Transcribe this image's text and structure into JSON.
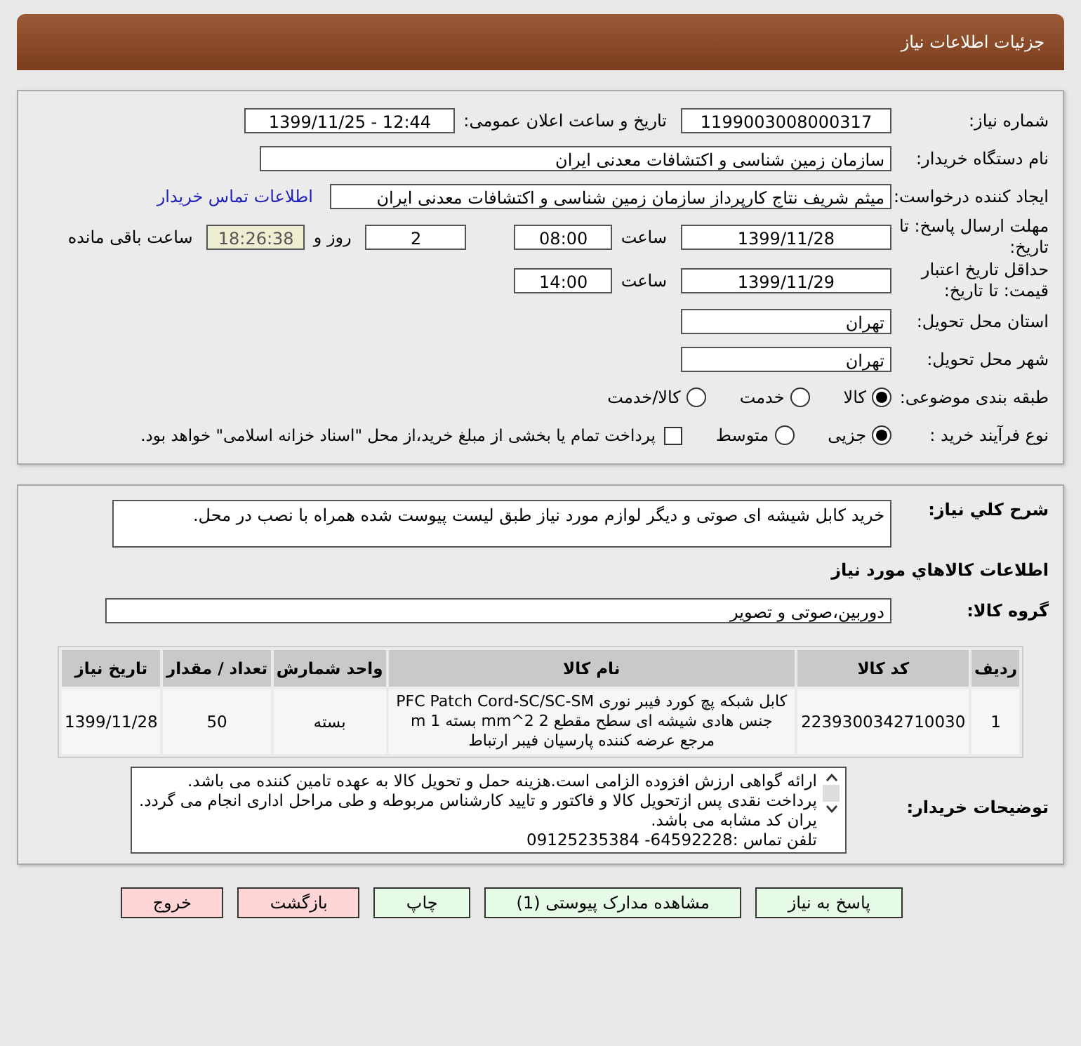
{
  "header": {
    "title": "جزئیات اطلاعات نیاز"
  },
  "need_number": {
    "label": "شماره نیاز:",
    "value": "1199003008000317"
  },
  "announce": {
    "label": "تاریخ و ساعت اعلان عمومی:",
    "value": "1399/11/25 - 12:44"
  },
  "buyer_org": {
    "label": "نام دستگاه خریدار:",
    "value": "سازمان زمین شناسی و اکتشافات معدنی ایران"
  },
  "requester": {
    "label": "ایجاد کننده درخواست:",
    "value": "میثم شریف نتاج کارپرداز سازمان زمین شناسی و اکتشافات معدنی ایران",
    "link": "اطلاعات تماس خریدار"
  },
  "deadline": {
    "label": "مهلت ارسال پاسخ: تا تاریخ:",
    "date": "1399/11/28",
    "time_label": "ساعت",
    "time": "08:00",
    "days": "2",
    "days_label": "روز و",
    "remaining": "18:26:38",
    "remaining_label": "ساعت باقی مانده"
  },
  "validity": {
    "label": "حداقل تاریخ اعتبار قیمت: تا تاریخ:",
    "date": "1399/11/29",
    "time_label": "ساعت",
    "time": "14:00"
  },
  "province": {
    "label": "استان محل تحویل:",
    "value": "تهران"
  },
  "city": {
    "label": "شهر محل تحویل:",
    "value": "تهران"
  },
  "category": {
    "label": "طبقه بندی موضوعی:",
    "options": [
      {
        "label": "کالا",
        "selected": true
      },
      {
        "label": "خدمت",
        "selected": false
      },
      {
        "label": "کالا/خدمت",
        "selected": false
      }
    ]
  },
  "purchase_type": {
    "label": "نوع فرآیند خرید :",
    "options": [
      {
        "label": "جزیی",
        "selected": true
      },
      {
        "label": "متوسط",
        "selected": false
      }
    ],
    "treasury": {
      "label": "پرداخت تمام یا بخشی از مبلغ خرید،از محل \"اسناد خزانه اسلامی\" خواهد بود.",
      "checked": false
    }
  },
  "description": {
    "label": "شرح کلي نياز:",
    "value": "خرید کابل شیشه ای صوتی و دیگر لوازم مورد نیاز طبق لیست پیوست شده همراه با نصب در محل."
  },
  "goods_title": "اطلاعات کالاهاي مورد نياز",
  "goods_group": {
    "label": "گروه کالا:",
    "value": "دوربین،صوتی و تصویر"
  },
  "table": {
    "columns": [
      "ردیف",
      "کد کالا",
      "نام کالا",
      "واحد شمارش",
      "تعداد / مقدار",
      "تاریخ نیاز"
    ],
    "rows": [
      {
        "cells": [
          "1",
          "2239300342710030",
          "کابل شبکه پچ کورد فیبر نوری PFC Patch Cord-SC/SC-SM\nجنس هادی شیشه ای سطح مقطع 2 mm^2 بسته 1 m\nمرجع عرضه کننده پارسیان فیبر ارتباط",
          "بسته",
          "50",
          "1399/11/28"
        ]
      }
    ]
  },
  "buyer_notes": {
    "label": "توضیحات خریدار:",
    "lines": [
      "ارائه گواهی ارزش افزوده الزامی است.هزینه حمل و تحویل کالا به عهده تامین کننده می باشد.",
      "پرداخت نقدی پس ازتحویل کالا و فاکتور و تایید کارشناس مربوطه و طی مراحل اداری انجام می گردد.",
      "یران کد مشابه می باشد.",
      "تلفن تماس :64592228- 09125235384"
    ]
  },
  "buttons": [
    {
      "label": "پاسخ به نیاز",
      "color": "#e6fbe6"
    },
    {
      "label": "مشاهده مدارک پیوستی (1)",
      "color": "#e6fbe6"
    },
    {
      "label": "چاپ",
      "color": "#e6fbe6"
    },
    {
      "label": "بازگشت",
      "color": "#ffd5d5"
    },
    {
      "label": "خروج",
      "color": "#ffd5d5"
    }
  ]
}
